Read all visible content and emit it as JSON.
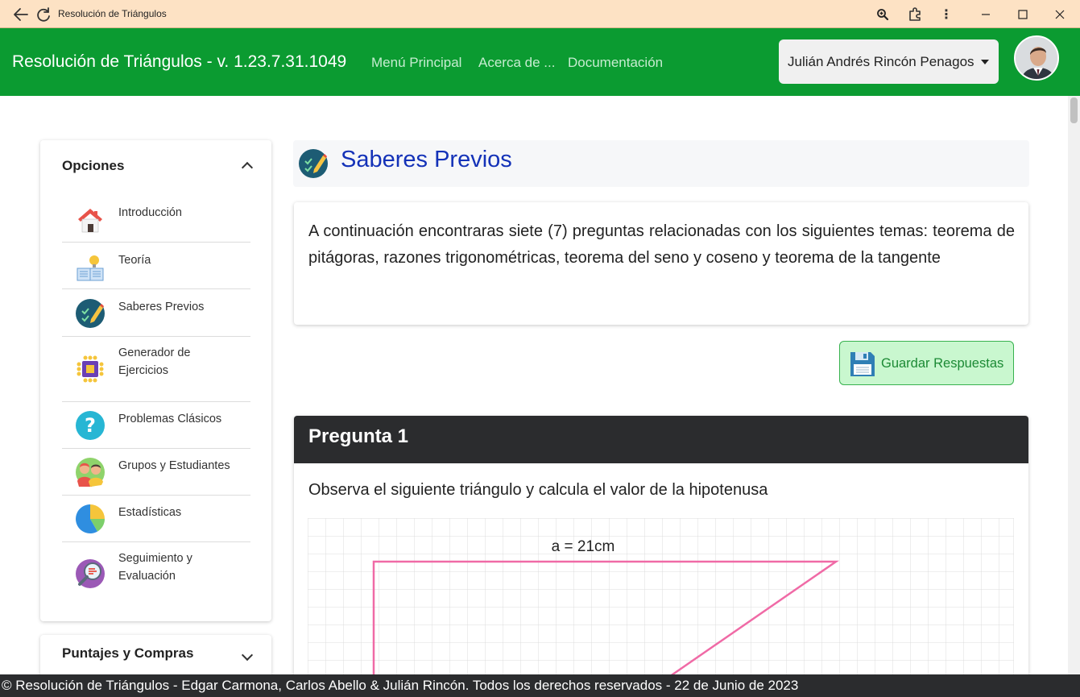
{
  "window": {
    "title": "Resolución de Triángulos",
    "icons": [
      "back-arrow-icon",
      "refresh-icon",
      "zoom-icon",
      "extensions-icon",
      "more-vertical-icon",
      "minimize-icon",
      "maximize-icon",
      "close-icon"
    ]
  },
  "navbar": {
    "brand": "Resolución de Triángulos - v. 1.23.7.31.1049",
    "links": [
      "Menú Principal",
      "Acerca de ...",
      "Documentación"
    ],
    "user": "Julián Andrés Rincón Penagos",
    "colors": {
      "background": "#0b9b31",
      "link": "#c6ecd0"
    }
  },
  "sidebar": {
    "header": "Opciones",
    "items": [
      {
        "label_1": "Introducción",
        "label_2": "",
        "icon": "house-icon"
      },
      {
        "label_1": "Teoría",
        "label_2": "",
        "icon": "book-lightbulb-icon"
      },
      {
        "label_1": "Saberes Previos",
        "label_2": "",
        "icon": "checklist-pencil-icon"
      },
      {
        "label_1": "Generador de",
        "label_2": "Ejercicios",
        "icon": "chip-icon"
      },
      {
        "label_1": "Problemas Clásicos",
        "label_2": "",
        "icon": "question-icon"
      },
      {
        "label_1": "Grupos y Estudiantes",
        "label_2": "",
        "icon": "students-icon"
      },
      {
        "label_1": "Estadísticas",
        "label_2": "",
        "icon": "pie-chart-icon"
      },
      {
        "label_1": "Seguimiento y",
        "label_2": "Evaluación",
        "icon": "magnifier-icon"
      }
    ],
    "section2": "Puntajes y Compras"
  },
  "main": {
    "page_title": "Saberes Previos",
    "intro": "A continuación encontraras siete (7) preguntas relacionadas con los siguientes temas: teorema de pitágoras, razones trigonométricas, teorema del seno y coseno y teorema de la tangente",
    "save_button": "Guardar Respuestas",
    "question": {
      "title": "Pregunta 1",
      "text": "Observa el siguiente triángulo y calcula el valor de la hipotenusa",
      "side_label": "a = 21cm",
      "triangle_color": "#f06aa6"
    }
  },
  "footer": "© Resolución de Triángulos - Edgar Carmona, Carlos Abello & Julián Rincón. Todos los derechos reservados - 22 de Junio de 2023"
}
